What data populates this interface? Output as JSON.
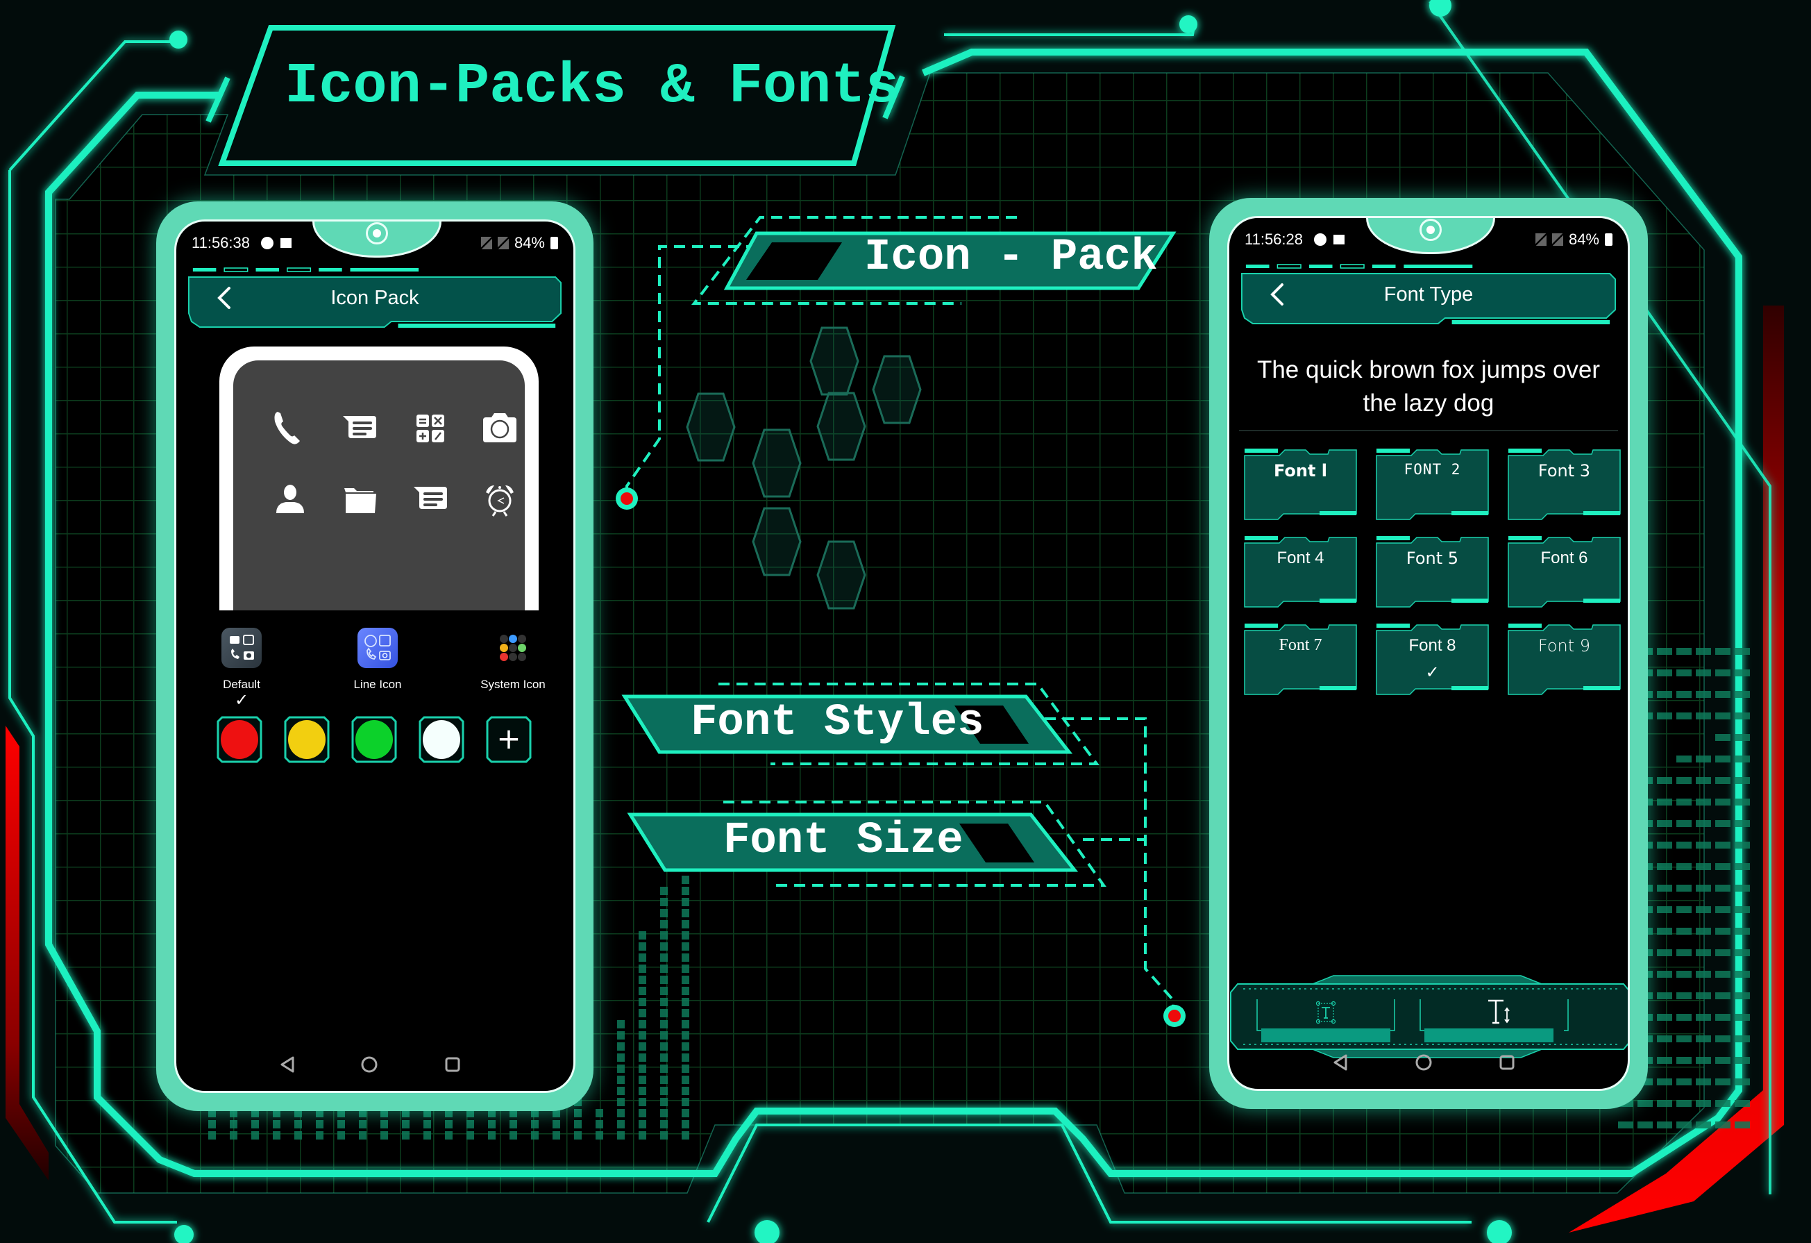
{
  "banner": {
    "title": "Icon-Packs & Fonts"
  },
  "labels": {
    "icon_pack": "Icon - Pack",
    "font_styles": "Font Styles",
    "font_size": "Font Size"
  },
  "colors": {
    "accent": "#1ff0c0",
    "accent_dark": "#0b6e5c",
    "panel": "#0a5548",
    "alert_red": "#ff1010",
    "background": "#020c0b",
    "grid": "#0c3a1e"
  },
  "left_phone": {
    "status": {
      "time": "11:56:38",
      "battery": "84%",
      "icons": [
        "data-saver-icon",
        "image-icon",
        "no-sim-icon",
        "no-sim-icon",
        "battery-charging-icon"
      ]
    },
    "appbar": {
      "title": "Icon Pack",
      "back_icon": "chevron-left-icon"
    },
    "preview_icons": [
      {
        "name": "phone-icon"
      },
      {
        "name": "message-icon"
      },
      {
        "name": "calculator-icon"
      },
      {
        "name": "camera-icon"
      },
      {
        "name": "contact-icon"
      },
      {
        "name": "folder-icon"
      },
      {
        "name": "message-icon"
      },
      {
        "name": "alarm-clock-icon"
      }
    ],
    "packs": [
      {
        "label": "Default",
        "selected": true,
        "check": "✓"
      },
      {
        "label": "Line Icon",
        "selected": false,
        "check": ""
      },
      {
        "label": "System Icon",
        "selected": false,
        "check": ""
      }
    ],
    "color_swatches": [
      {
        "name": "red",
        "color": "#ee1111"
      },
      {
        "name": "yellow",
        "color": "#f2cf10"
      },
      {
        "name": "green",
        "color": "#0cd12a"
      },
      {
        "name": "white",
        "color": "#f5fffd"
      }
    ],
    "add_color_label": "+"
  },
  "right_phone": {
    "status": {
      "time": "11:56:28",
      "battery": "84%",
      "icons": [
        "data-saver-icon",
        "image-icon",
        "no-sim-icon",
        "no-sim-icon",
        "battery-charging-icon"
      ]
    },
    "appbar": {
      "title": "Font Type",
      "back_icon": "chevron-left-icon"
    },
    "sample_text": "The quick brown fox jumps over the lazy dog",
    "fonts": [
      {
        "label": "Font l",
        "selected": false
      },
      {
        "label": "FONT 2",
        "selected": false
      },
      {
        "label": "Font 3",
        "selected": false
      },
      {
        "label": "Font 4",
        "selected": false
      },
      {
        "label": "Font 5",
        "selected": false
      },
      {
        "label": "Font 6",
        "selected": false
      },
      {
        "label": "Font 7",
        "selected": false
      },
      {
        "label": "Font 8",
        "selected": true
      },
      {
        "label": "Font 9",
        "selected": false
      }
    ],
    "selected_check": "✓",
    "tools": [
      {
        "name": "font-style-tool",
        "icon": "text-box-icon"
      },
      {
        "name": "font-size-tool",
        "icon": "text-size-icon"
      }
    ]
  },
  "navbar": {
    "buttons": [
      "back-triangle-icon",
      "home-circle-icon",
      "recents-square-icon"
    ]
  }
}
